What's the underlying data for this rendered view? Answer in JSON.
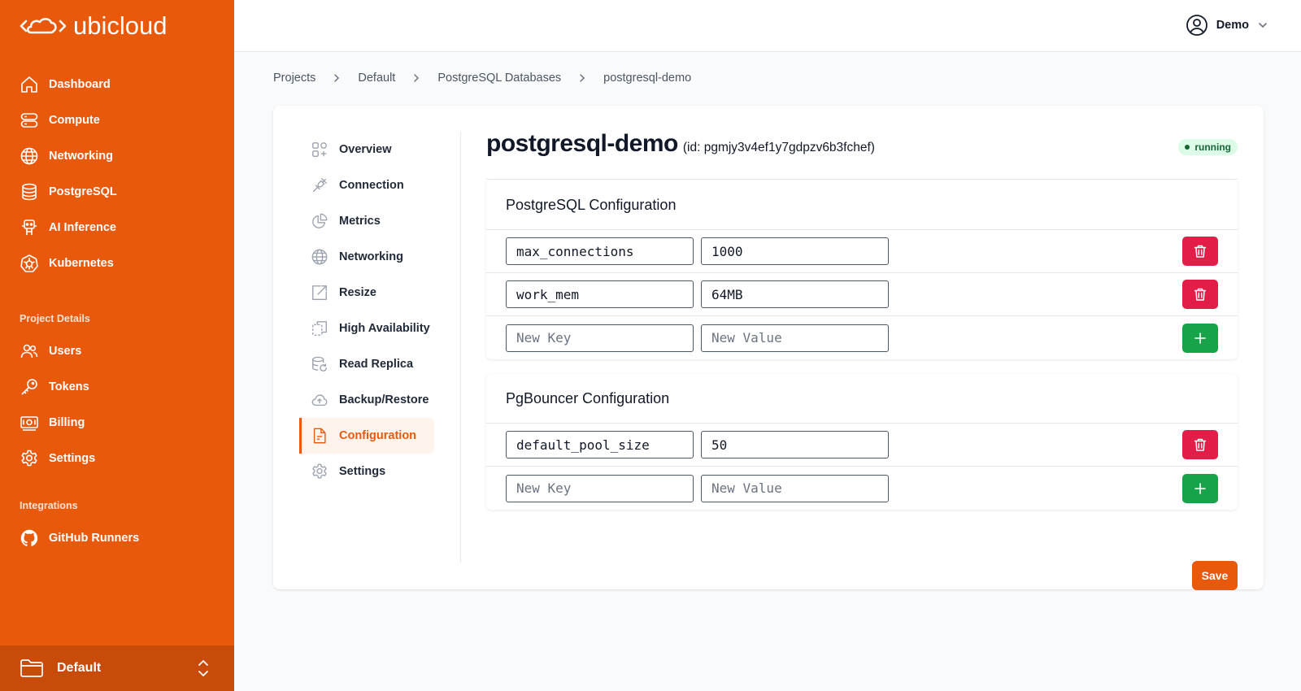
{
  "brand": {
    "name": "ubicloud"
  },
  "sidebar": {
    "items": [
      {
        "label": "Dashboard",
        "icon": "home-icon"
      },
      {
        "label": "Compute",
        "icon": "server-icon"
      },
      {
        "label": "Networking",
        "icon": "globe-icon"
      },
      {
        "label": "PostgreSQL",
        "icon": "database-icon"
      },
      {
        "label": "AI Inference",
        "icon": "robot-icon"
      },
      {
        "label": "Kubernetes",
        "icon": "kubernetes-icon"
      }
    ],
    "project_details_heading": "Project Details",
    "project_items": [
      {
        "label": "Users",
        "icon": "users-icon"
      },
      {
        "label": "Tokens",
        "icon": "key-icon"
      },
      {
        "label": "Billing",
        "icon": "banknote-icon"
      },
      {
        "label": "Settings",
        "icon": "gear-icon"
      }
    ],
    "integrations_heading": "Integrations",
    "integration_items": [
      {
        "label": "GitHub Runners",
        "icon": "github-icon"
      }
    ],
    "project_switcher": {
      "label": "Default"
    }
  },
  "topbar": {
    "user_name": "Demo"
  },
  "breadcrumb": [
    "Projects",
    "Default",
    "PostgreSQL Databases",
    "postgresql-demo"
  ],
  "subnav": {
    "items": [
      {
        "label": "Overview",
        "icon": "squares-plus-icon"
      },
      {
        "label": "Connection",
        "icon": "plug-icon"
      },
      {
        "label": "Metrics",
        "icon": "pie-chart-icon"
      },
      {
        "label": "Networking",
        "icon": "globe-icon"
      },
      {
        "label": "Resize",
        "icon": "external-square-icon"
      },
      {
        "label": "High Availability",
        "icon": "copy-squares-icon"
      },
      {
        "label": "Read Replica",
        "icon": "database-refresh-icon"
      },
      {
        "label": "Backup/Restore",
        "icon": "cloud-upload-icon"
      },
      {
        "label": "Configuration",
        "icon": "document-icon"
      },
      {
        "label": "Settings",
        "icon": "gear-icon"
      }
    ],
    "active": "Configuration"
  },
  "resource": {
    "name": "postgresql-demo",
    "id_text": "(id: pgmjy3v4ef1y7gdpzv6b3fchef)",
    "status": "running"
  },
  "pg_config": {
    "title": "PostgreSQL Configuration",
    "rows": [
      {
        "key": "max_connections",
        "value": "1000"
      },
      {
        "key": "work_mem",
        "value": "64MB"
      }
    ],
    "new_key_placeholder": "New Key",
    "new_value_placeholder": "New Value"
  },
  "pgbouncer_config": {
    "title": "PgBouncer Configuration",
    "rows": [
      {
        "key": "default_pool_size",
        "value": "50"
      }
    ],
    "new_key_placeholder": "New Key",
    "new_value_placeholder": "New Value"
  },
  "save_label": "Save",
  "colors": {
    "brand": "#e8590c",
    "delete": "#e11d48",
    "add": "#16a34a",
    "status_bg": "#dcfce7",
    "status_fg": "#166534"
  }
}
